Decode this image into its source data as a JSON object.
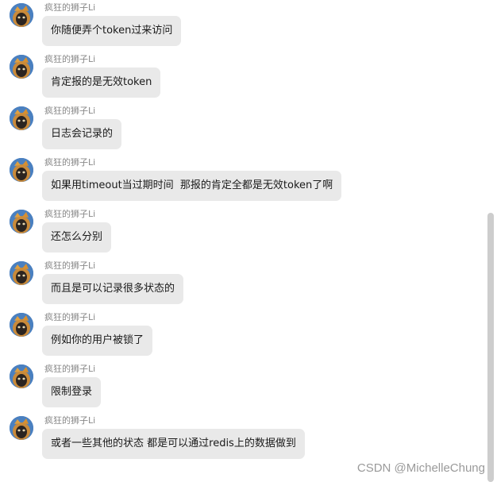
{
  "messages": [
    {
      "sender": "疯狂的狮子Li",
      "text": "你随便弄个token过来访问"
    },
    {
      "sender": "疯狂的狮子Li",
      "text": "肯定报的是无效token"
    },
    {
      "sender": "疯狂的狮子Li",
      "text": "日志会记录的"
    },
    {
      "sender": "疯狂的狮子Li",
      "text": "如果用timeout当过期时间  那报的肯定全都是无效token了啊"
    },
    {
      "sender": "疯狂的狮子Li",
      "text": "还怎么分别"
    },
    {
      "sender": "疯狂的狮子Li",
      "text": "而且是可以记录很多状态的"
    },
    {
      "sender": "疯狂的狮子Li",
      "text": "例如你的用户被锁了"
    },
    {
      "sender": "疯狂的狮子Li",
      "text": "限制登录"
    },
    {
      "sender": "疯狂的狮子Li",
      "text": "或者一些其他的状态 都是可以通过redis上的数据做到"
    }
  ],
  "watermark": "CSDN @MichelleChung",
  "colors": {
    "bubble": "#e9e9e9",
    "sender_name": "#888888",
    "scrollbar": "#cdcdcd"
  },
  "icons": {
    "avatar": "avatar-lion-icon"
  }
}
